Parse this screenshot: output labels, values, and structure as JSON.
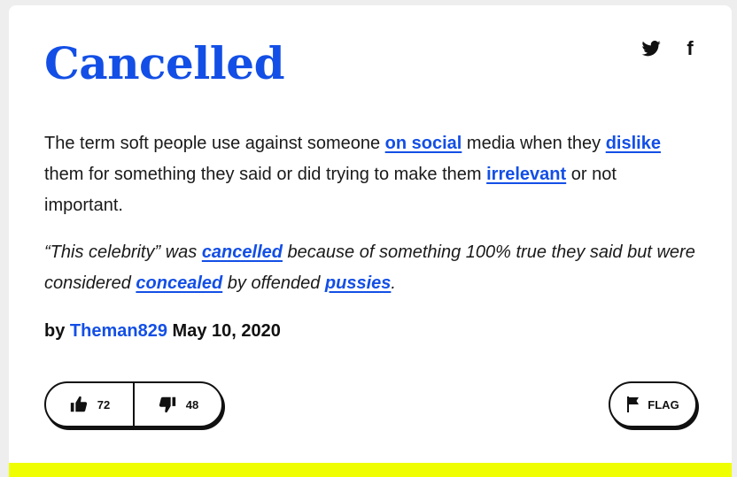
{
  "definition": {
    "word": "Cancelled",
    "meaning": [
      {
        "text": "The term soft people use against someone "
      },
      {
        "text": "on social",
        "link": true
      },
      {
        "text": " media when they "
      },
      {
        "text": "dislike",
        "link": true
      },
      {
        "text": " them for something they said or did trying to make them "
      },
      {
        "text": "irrelevant",
        "link": true
      },
      {
        "text": " or not important."
      }
    ],
    "example": [
      {
        "text": "“This celebrity” was "
      },
      {
        "text": "cancelled",
        "link": true
      },
      {
        "text": " because of something 100% true they said but were considered "
      },
      {
        "text": "concealed",
        "link": true
      },
      {
        "text": " by offended "
      },
      {
        "text": "pussies",
        "link": true
      },
      {
        "text": "."
      }
    ],
    "by_label": "by",
    "author": "Theman829",
    "date": "May 10, 2020"
  },
  "votes": {
    "up_count": "72",
    "down_count": "48"
  },
  "flag_label": "FLAG",
  "share": {
    "twitter_icon": "twitter-icon",
    "facebook_icon": "facebook-icon",
    "facebook_glyph": "f"
  },
  "colors": {
    "link": "#134fe6",
    "accent_bar": "#effe00"
  }
}
